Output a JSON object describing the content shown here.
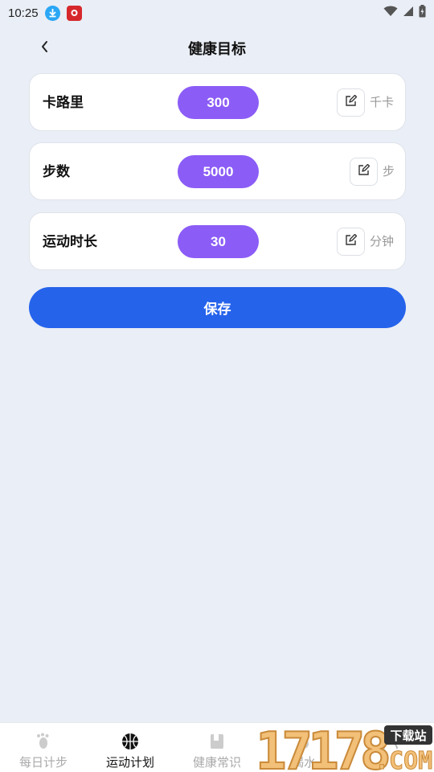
{
  "status_bar": {
    "time": "10:25",
    "icons": [
      "download-icon",
      "app-notification-icon",
      "wifi-icon",
      "signal-icon",
      "battery-icon"
    ]
  },
  "header": {
    "title": "健康目标",
    "back_icon": "chevron-left-icon"
  },
  "goals": [
    {
      "label": "卡路里",
      "value": "300",
      "unit": "千卡",
      "edit_icon": "edit-icon"
    },
    {
      "label": "步数",
      "value": "5000",
      "unit": "步",
      "edit_icon": "edit-icon"
    },
    {
      "label": "运动时长",
      "value": "30",
      "unit": "分钟",
      "edit_icon": "edit-icon"
    }
  ],
  "save_label": "保存",
  "bottom_nav": {
    "items": [
      {
        "label": "每日计步",
        "icon": "footprint-icon",
        "active": false
      },
      {
        "label": "运动计划",
        "icon": "basketball-icon",
        "active": true
      },
      {
        "label": "健康常识",
        "icon": "book-icon",
        "active": false
      },
      {
        "label": "喝水",
        "icon": "water-icon",
        "active": false
      },
      {
        "label": "",
        "icon": "profile-icon",
        "active": false
      }
    ]
  },
  "watermark": {
    "text": "17178.COM",
    "badge": "下载站"
  },
  "colors": {
    "background": "#eaeef6",
    "pill": "#8b5cf6",
    "primary": "#2563eb"
  }
}
